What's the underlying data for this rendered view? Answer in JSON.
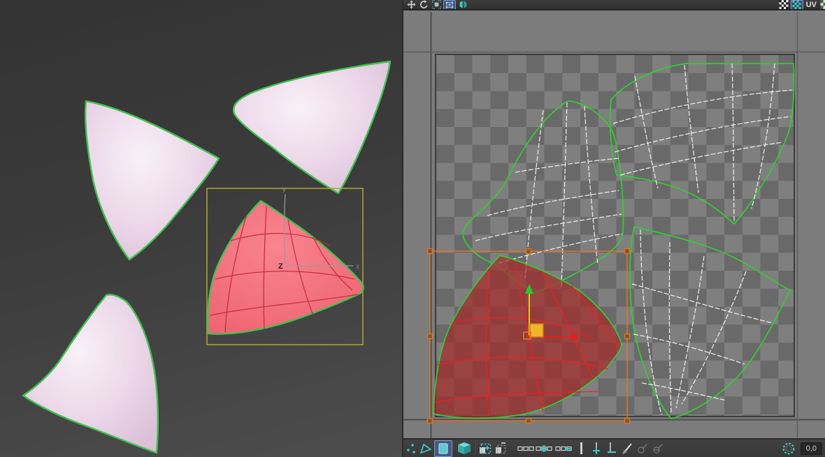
{
  "app": {
    "name": "uv-unwrap-workspace",
    "description": "3D viewport with four petal-shaped mesh shells (one selected) beside a UV editor showing the corresponding UV islands over a checker tile"
  },
  "left_viewport": {
    "axis_labels": {
      "y": "y",
      "z": "Z",
      "x": "x"
    },
    "object_fill": "#ecd8ea",
    "selected_fill": "#f4717f",
    "selected_wire": "#c22736",
    "edge_color": "#3fc24f",
    "selection_box_color": "#b3a33a"
  },
  "uv_editor": {
    "top_toolbar": {
      "space_label": "UV",
      "items": [
        {
          "name": "move-tool",
          "active": false
        },
        {
          "name": "rotate-tool",
          "active": false
        },
        {
          "name": "scale-tool",
          "active": false
        },
        {
          "name": "freeform-mode",
          "active": true
        },
        {
          "name": "mirror-tool",
          "active": false
        },
        {
          "name": "checker-pattern-toggle",
          "active": false
        },
        {
          "name": "show-map-toggle",
          "active": true
        },
        {
          "name": "uv-space-selector",
          "active": false
        }
      ]
    },
    "canvas": {
      "checker_light": "#7f7f7f",
      "checker_dark": "#696969",
      "shell_outline_color": "#35cc35",
      "wire_color": "#f2f2f2",
      "selected_shell_fill": "#a82424",
      "selected_shell_wire": "#ef2020",
      "selection_bbox_color": "#e8761e",
      "gizmo_u_color": "#e02020",
      "gizmo_v_color": "#28c828",
      "gizmo_handle_color": "#f0b428"
    },
    "bottom_toolbar": {
      "coords": "0,0",
      "items": [
        {
          "name": "vertex-mode",
          "active": false
        },
        {
          "name": "edge-mode",
          "active": false
        },
        {
          "name": "polygon-mode",
          "active": true
        },
        {
          "name": "element-mode",
          "active": false
        },
        {
          "name": "grow-selection",
          "active": false
        },
        {
          "name": "shrink-selection",
          "active": false
        },
        {
          "name": "select-loop",
          "active": false
        },
        {
          "name": "grow-loop",
          "active": false
        },
        {
          "name": "shrink-loop",
          "active": false
        },
        {
          "name": "align-vertical",
          "active": false
        },
        {
          "name": "align-horizontal",
          "active": false
        },
        {
          "name": "edit-seams",
          "active": false
        },
        {
          "name": "point-to-point-seam",
          "disabled": true
        },
        {
          "name": "convert-seam",
          "disabled": true
        },
        {
          "name": "paint-select-brush",
          "active": false
        }
      ]
    }
  },
  "icons": {
    "move-tool": "four-way-arrow-cross",
    "rotate-tool": "circular-arrow",
    "scale-tool": "square-with-corner-brackets",
    "freeform-mode": "square-with-plus",
    "mirror-tool": "mirrored-slabs",
    "checker-pattern-toggle": "bw-checkerboard",
    "show-map-toggle": "teal-checkerboard",
    "vertex-mode": "three-plus-marks",
    "edge-mode": "triangle-outline",
    "polygon-mode": "filled-square",
    "element-mode": "cube",
    "grow-selection": "dashed-square-plus",
    "shrink-selection": "dashed-square-minus",
    "loop-icons": "three-small-squares",
    "paint-select-brush": "dashed-circle"
  }
}
